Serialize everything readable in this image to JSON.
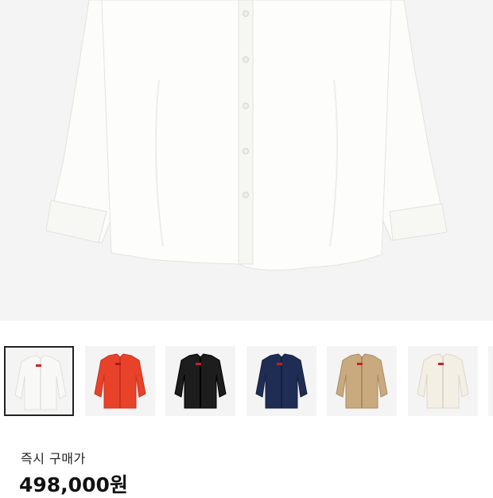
{
  "product": {
    "main_image": {
      "icon": "white-button-shirt",
      "color": "#fbfbf9"
    },
    "thumbnails": [
      {
        "color": "#f8f8f6",
        "detail": "#e6e6e1",
        "logo": "#cc2222",
        "selected": true
      },
      {
        "color": "#e8422a",
        "detail": "#c9331f",
        "logo": "#b01a12",
        "selected": false
      },
      {
        "color": "#1d1d1d",
        "detail": "#000000",
        "logo": "#c62020",
        "selected": false
      },
      {
        "color": "#1f2d55",
        "detail": "#16203d",
        "logo": "#c62020",
        "selected": false
      },
      {
        "color": "#c9a97e",
        "detail": "#a98c66",
        "logo": "#c62020",
        "selected": false
      },
      {
        "color": "#f3efe4",
        "detail": "#dcd7cb",
        "logo": "#c62020",
        "selected": false
      }
    ]
  },
  "pricing": {
    "label": "즉시 구매가",
    "value": "498,000원"
  }
}
